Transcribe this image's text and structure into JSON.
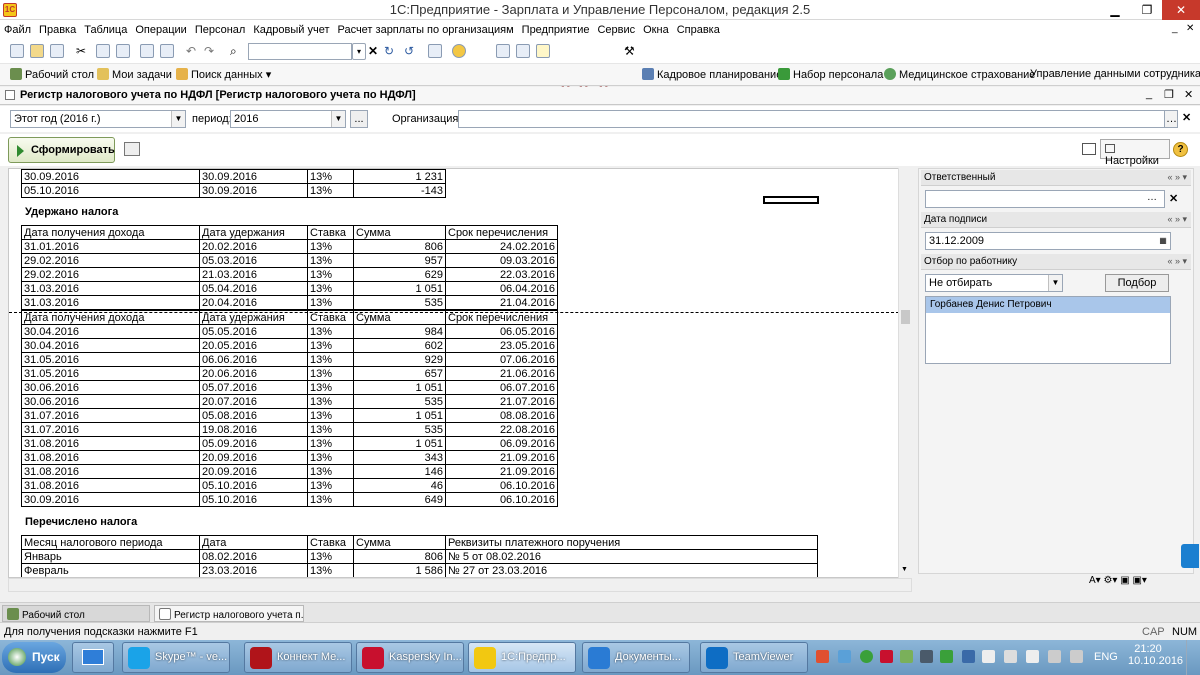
{
  "window": {
    "title": "1С:Предприятие - Зарплата и Управление Персоналом, редакция 2.5"
  },
  "menu": [
    "Файл",
    "Правка",
    "Таблица",
    "Операции",
    "Персонал",
    "Кадровый учет",
    "Расчет зарплаты по организациям",
    "Предприятие",
    "Сервис",
    "Окна",
    "Справка"
  ],
  "toolbar2": {
    "desktop": "Рабочий стол",
    "tasks": "Мои задачи",
    "search": "Поиск данных",
    "planning": "Кадровое планирование",
    "recruit": "Набор персонала",
    "medical": "Медицинское страхование",
    "data_mgmt": "Управление данными сотрудника"
  },
  "doc": {
    "title": "Регистр налогового учета по НДФЛ [Регистр налогового учета по НДФЛ]"
  },
  "filter": {
    "period_choice": "Этот год (2016 г.)",
    "period_label": "период:",
    "period_value": "2016",
    "more": "...",
    "org_label": "Организация:",
    "org_value": ""
  },
  "actions": {
    "generate": "Сформировать",
    "settings": "Настройки"
  },
  "report": {
    "top_rows": [
      [
        "30.09.2016",
        "30.09.2016",
        "13%",
        "1 231"
      ],
      [
        "05.10.2016",
        "30.09.2016",
        "13%",
        "-143"
      ]
    ],
    "withheld_title": "Удержано налога",
    "withheld_headers": [
      "Дата получения дохода",
      "Дата удержания",
      "Ставка",
      "Сумма",
      "Срок перечисления"
    ],
    "withheld_rows_1": [
      [
        "31.01.2016",
        "20.02.2016",
        "13%",
        "806",
        "24.02.2016"
      ],
      [
        "29.02.2016",
        "05.03.2016",
        "13%",
        "957",
        "09.03.2016"
      ],
      [
        "29.02.2016",
        "21.03.2016",
        "13%",
        "629",
        "22.03.2016"
      ],
      [
        "31.03.2016",
        "05.04.2016",
        "13%",
        "1 051",
        "06.04.2016"
      ],
      [
        "31.03.2016",
        "20.04.2016",
        "13%",
        "535",
        "21.04.2016"
      ]
    ],
    "withheld_rows_2": [
      [
        "30.04.2016",
        "05.05.2016",
        "13%",
        "984",
        "06.05.2016"
      ],
      [
        "30.04.2016",
        "20.05.2016",
        "13%",
        "602",
        "23.05.2016"
      ],
      [
        "31.05.2016",
        "06.06.2016",
        "13%",
        "929",
        "07.06.2016"
      ],
      [
        "31.05.2016",
        "20.06.2016",
        "13%",
        "657",
        "21.06.2016"
      ],
      [
        "30.06.2016",
        "05.07.2016",
        "13%",
        "1 051",
        "06.07.2016"
      ],
      [
        "30.06.2016",
        "20.07.2016",
        "13%",
        "535",
        "21.07.2016"
      ],
      [
        "31.07.2016",
        "05.08.2016",
        "13%",
        "1 051",
        "08.08.2016"
      ],
      [
        "31.07.2016",
        "19.08.2016",
        "13%",
        "535",
        "22.08.2016"
      ],
      [
        "31.08.2016",
        "05.09.2016",
        "13%",
        "1 051",
        "06.09.2016"
      ],
      [
        "31.08.2016",
        "20.09.2016",
        "13%",
        "343",
        "21.09.2016"
      ],
      [
        "31.08.2016",
        "20.09.2016",
        "13%",
        "146",
        "21.09.2016"
      ],
      [
        "31.08.2016",
        "05.10.2016",
        "13%",
        "46",
        "06.10.2016"
      ],
      [
        "30.09.2016",
        "05.10.2016",
        "13%",
        "649",
        "06.10.2016"
      ]
    ],
    "paid_title": "Перечислено налога",
    "paid_headers": [
      "Месяц налогового периода",
      "Дата",
      "Ставка",
      "Сумма",
      "Реквизиты платежного поручения"
    ],
    "paid_rows": [
      [
        "Январь",
        "08.02.2016",
        "13%",
        "806",
        "№ 5 от 08.02.2016"
      ],
      [
        "Февраль",
        "23.03.2016",
        "13%",
        "1 586",
        "№ 27 от 23.03.2016"
      ]
    ]
  },
  "panel": {
    "responsible_label": "Ответственный",
    "responsible_value": "",
    "sign_date_label": "Дата подписи",
    "sign_date_value": "31.12.2009",
    "employee_filter_label": "Отбор по работнику",
    "employee_filter_value": "Не отбирать",
    "select_button": "Подбор",
    "employees": [
      "Горбанев Денис Петрович"
    ]
  },
  "window_tabs": [
    "Рабочий стол",
    "Регистр налогового учета п..."
  ],
  "status": {
    "hint": "Для получения подсказки нажмите F1",
    "caps": "CAP",
    "num": "NUM"
  },
  "taskbar": {
    "start": "Пуск",
    "apps": [
      {
        "label": "Skype™ - ve...",
        "color": "#1aa3e8"
      },
      {
        "label": "Коннект Ме...",
        "color": "#b0141a"
      },
      {
        "label": "Kaspersky In...",
        "color": "#c8102e"
      },
      {
        "label": "1С:Предпр...",
        "color": "#f2c811"
      },
      {
        "label": "Документы...",
        "color": "#2a7bd4"
      },
      {
        "label": "TeamViewer",
        "color": "#0e6dc4"
      }
    ],
    "lang": "ENG",
    "time": "21:20",
    "date": "10.10.2016"
  }
}
